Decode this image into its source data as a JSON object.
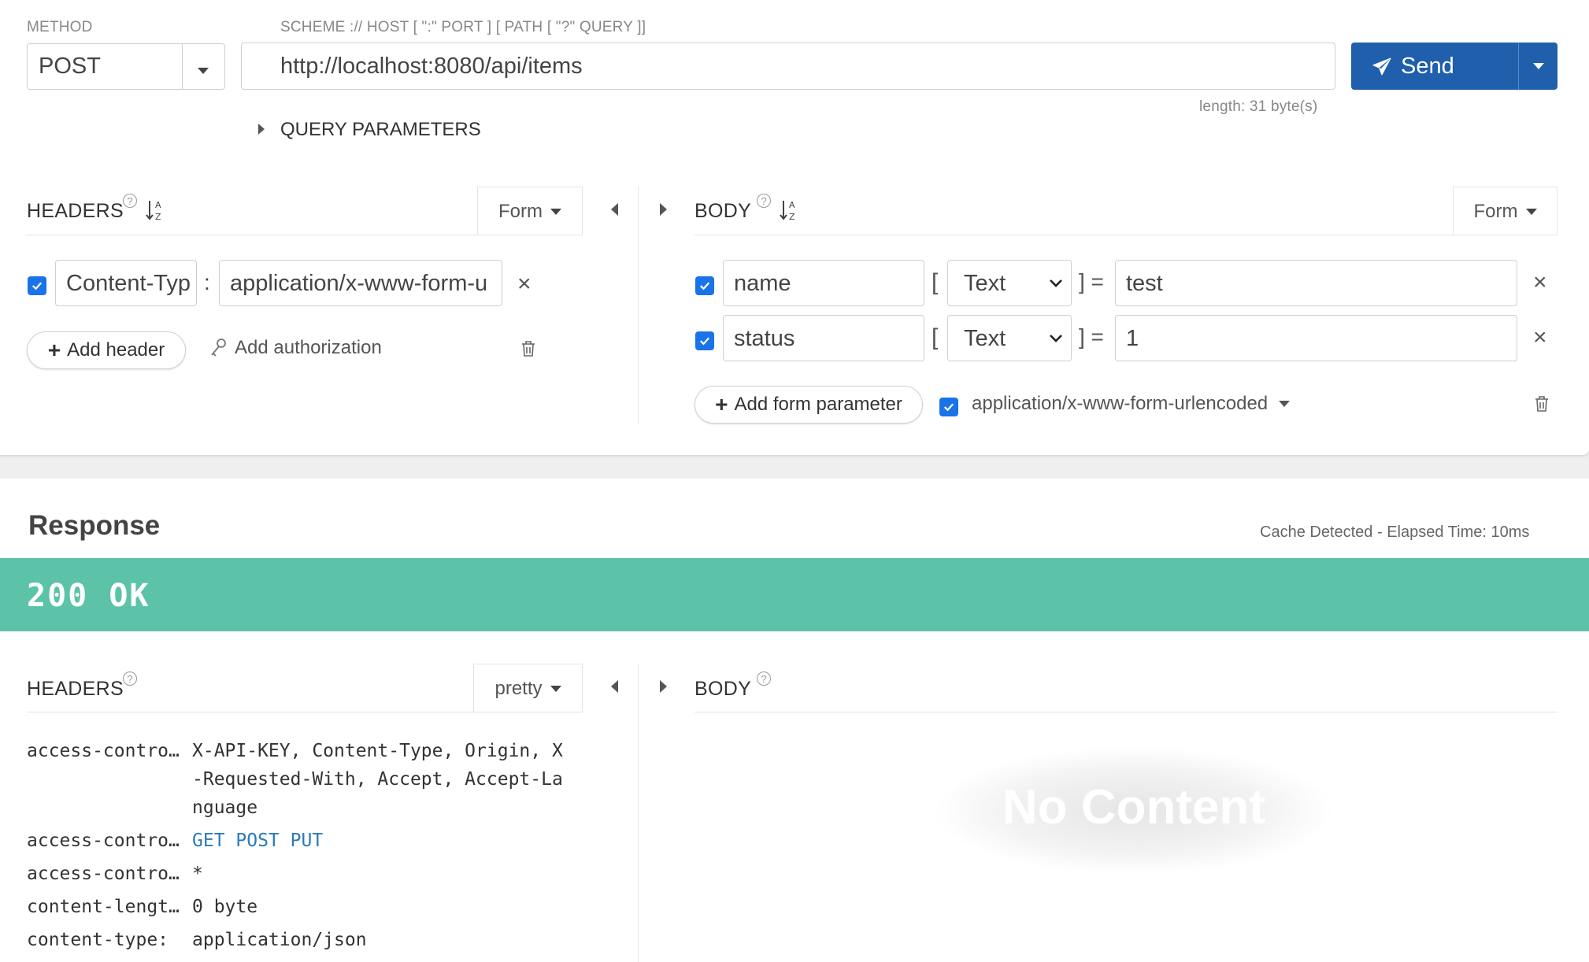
{
  "request": {
    "method_label": "METHOD",
    "method_value": "POST",
    "url_label": "SCHEME :// HOST [ \":\" PORT ] [ PATH [ \"?\" QUERY ]]",
    "url_value": "http://localhost:8080/api/items",
    "send_label": "Send",
    "length_text": "length: 31 byte(s)",
    "query_params_label": "QUERY PARAMETERS"
  },
  "req_headers": {
    "title": "HEADERS",
    "mode_label": "Form",
    "rows": [
      {
        "name": "Content-Typ",
        "value": "application/x-www-form-u",
        "checked": true
      }
    ],
    "add_header_label": "Add header",
    "add_auth_label": "Add authorization"
  },
  "req_body": {
    "title": "BODY",
    "mode_label": "Form",
    "rows": [
      {
        "name": "name",
        "type": "Text",
        "value": "test",
        "checked": true
      },
      {
        "name": "status",
        "type": "Text",
        "value": "1",
        "checked": true
      }
    ],
    "add_param_label": "Add form parameter",
    "content_type": "application/x-www-form-urlencoded"
  },
  "response": {
    "title": "Response",
    "meta": "Cache Detected - Elapsed Time: 10ms",
    "status": "200 OK",
    "status_color": "#5cc3a8",
    "headers_title": "HEADERS",
    "headers_mode": "pretty",
    "body_title": "BODY",
    "no_content": "No Content",
    "headers": [
      {
        "key": "access-contro…",
        "lines": [
          "X-API-KEY, Content-Type, Origin, X",
          "-Requested-With, Accept, Accept-La",
          "nguage"
        ]
      },
      {
        "key": "access-contro…",
        "lines": [
          "GET POST PUT"
        ],
        "link": true
      },
      {
        "key": "access-contro…",
        "lines": [
          "*"
        ]
      },
      {
        "key": "content-lengt…",
        "lines": [
          "0 byte"
        ]
      },
      {
        "key": "content-type:",
        "lines": [
          "application/json"
        ]
      }
    ]
  },
  "colors": {
    "accent": "#1f5fac",
    "checkbox": "#1a73e8",
    "link": "#2a7ab8"
  }
}
